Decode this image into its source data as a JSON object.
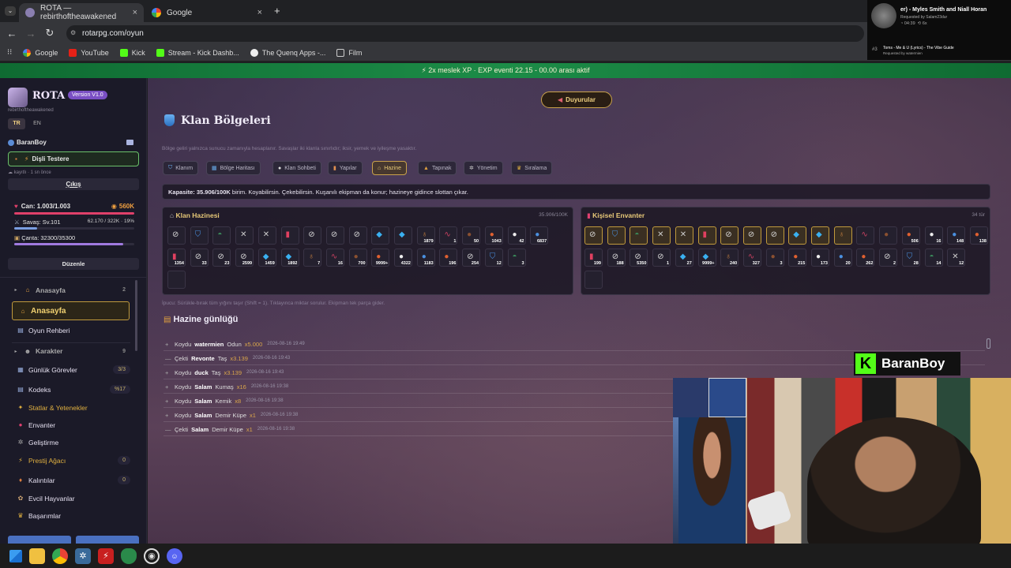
{
  "browser": {
    "tabs": [
      {
        "title": "ROTA — rebirthoftheawakened",
        "close": "×"
      },
      {
        "title": "Google",
        "close": "×"
      }
    ],
    "new_tab": "+",
    "url": "rotarpg.com/oyun",
    "bookmarks": [
      "Google",
      "YouTube",
      "Kick",
      "Stream - Kick Dashb...",
      "The Quenq Apps -...",
      "Film"
    ]
  },
  "music": {
    "title": "er) - Myles Smith and Niall Horan",
    "requested": "Requested by Salam23dur",
    "time": "04:39",
    "count": "6x",
    "next_num": "#3",
    "next_title": "Toms - Me & U (Lyrics) - The Vibe Guide",
    "next_requested": "Requested by watermien"
  },
  "banner": "⚡ 2x meslek XP · EXP eventi 22.15 - 00.00 arası aktif",
  "sidebar": {
    "logo": "ROTA",
    "version": "Version V1.0",
    "subtitle": "rebirthoftheawakened",
    "lang_tr": "TR",
    "lang_en": "EN",
    "username": "BaranBoy",
    "title_badge": "Dişli Testere",
    "status": "kayıtlı · 1 sn önce",
    "logout": "Çıkış",
    "hp": "Can: 1.003/1.003",
    "gold": "560K",
    "war": "Savaş: Sv.101",
    "xp": "62.170 / 322K · 19%",
    "bag": "Çanta: 32300/35300",
    "edit": "Düzenle",
    "nav": [
      {
        "label": "Anasayfa",
        "badge": "2",
        "type": "group"
      },
      {
        "label": "Anasayfa",
        "badge": "",
        "type": "active"
      },
      {
        "label": "Oyun Rehberi",
        "badge": "",
        "type": "item"
      },
      {
        "label": "Karakter",
        "badge": "9",
        "type": "group"
      },
      {
        "label": "Günlük Görevler",
        "badge": "3/3",
        "type": "item"
      },
      {
        "label": "Kodeks",
        "badge": "%17",
        "type": "item"
      },
      {
        "label": "Statlar & Yetenekler",
        "badge": "",
        "type": "item"
      },
      {
        "label": "Envanter",
        "badge": "",
        "type": "item"
      },
      {
        "label": "Geliştirme",
        "badge": "",
        "type": "item"
      },
      {
        "label": "Prestij Ağacı",
        "badge": "0",
        "type": "item"
      },
      {
        "label": "Kalıntılar",
        "badge": "0",
        "type": "item"
      },
      {
        "label": "Evcil Hayvanlar",
        "badge": "",
        "type": "item"
      },
      {
        "label": "Başarımlar",
        "badge": "",
        "type": "item"
      }
    ]
  },
  "main": {
    "announce": "Duyurular",
    "title": "Klan Bölgeleri",
    "hint": "Bölge geliri yalnızca sunucu zamanıyla hesaplanır. Savaşlar iki klanla sınırlıdır; iksir, yemek ve iyileşme yasaktır.",
    "tabs": [
      "Klanım",
      "Bölge Haritası",
      "Klan Sohbeti",
      "Yapılar",
      "Hazine",
      "Tapınak",
      "Yönetim",
      "Sıralama"
    ],
    "active_tab": "Hazine",
    "capacity_label": "Kapasite:",
    "capacity_value": "35.906/100K",
    "capacity_rest": "birim. Koyabilirsin. Çekebilirsin. Kuşanılı ekipman da konur; hazineye gidince slottan çıkar.",
    "treasury_title": "Klan Hazinesi",
    "treasury_count": "35.906/100K",
    "personal_title": "Kişisel Envanter",
    "personal_count": "34 tür",
    "tip": "İpucu: Sürükle-bırak tüm yığını taşır (Shift = 1). Tıklayınca miktar sorulur. Ekipman tek parça gider.",
    "log_title": "Hazine günlüğü",
    "log": [
      {
        "sym": "+",
        "action": "Koydu",
        "user": "watermien",
        "item": "Odun",
        "qty": "x5.000",
        "ts": "2026-08-16 19:49"
      },
      {
        "sym": "—",
        "action": "Çekti",
        "user": "Revonte",
        "item": "Taş",
        "qty": "x3.139",
        "ts": "2026-08-16 19:43"
      },
      {
        "sym": "+",
        "action": "Koydu",
        "user": "duck",
        "item": "Taş",
        "qty": "x3.139",
        "ts": "2026-08-16 19:43"
      },
      {
        "sym": "+",
        "action": "Koydu",
        "user": "Salam",
        "item": "Kumaş",
        "qty": "x16",
        "ts": "2026-08-16 19:38"
      },
      {
        "sym": "+",
        "action": "Koydu",
        "user": "Salam",
        "item": "Kemik",
        "qty": "x8",
        "ts": "2026-08-16 19:38"
      },
      {
        "sym": "+",
        "action": "Koydu",
        "user": "Salam",
        "item": "Demir Küpe",
        "qty": "x1",
        "ts": "2026-08-16 19:38"
      },
      {
        "sym": "—",
        "action": "Çekti",
        "user": "Salam",
        "item": "Demir Küpe",
        "qty": "x1",
        "ts": "2026-08-16 19:38"
      }
    ]
  },
  "treasury_row1": [
    "",
    "",
    "",
    "",
    "",
    "",
    "",
    "",
    "",
    "",
    "",
    "1879",
    "1",
    "50",
    "1043",
    "42",
    "6837"
  ],
  "treasury_row2": [
    "1354",
    "33",
    "23",
    "2599",
    "1459",
    "1892",
    "7",
    "16",
    "700",
    "9999+",
    "4322",
    "1183",
    "196",
    "254",
    "12",
    "3"
  ],
  "personal_row1": [
    "",
    "",
    "",
    "",
    "",
    "",
    "",
    "",
    "",
    "",
    "",
    "",
    "",
    "",
    "506",
    "16",
    "148",
    "138"
  ],
  "personal_row2": [
    "199",
    "188",
    "5350",
    "1",
    "27",
    "9999+",
    "240",
    "327",
    "3",
    "215",
    "173",
    "20",
    "262",
    "2",
    "28",
    "14",
    "12"
  ],
  "streamer": "BaranBoy"
}
